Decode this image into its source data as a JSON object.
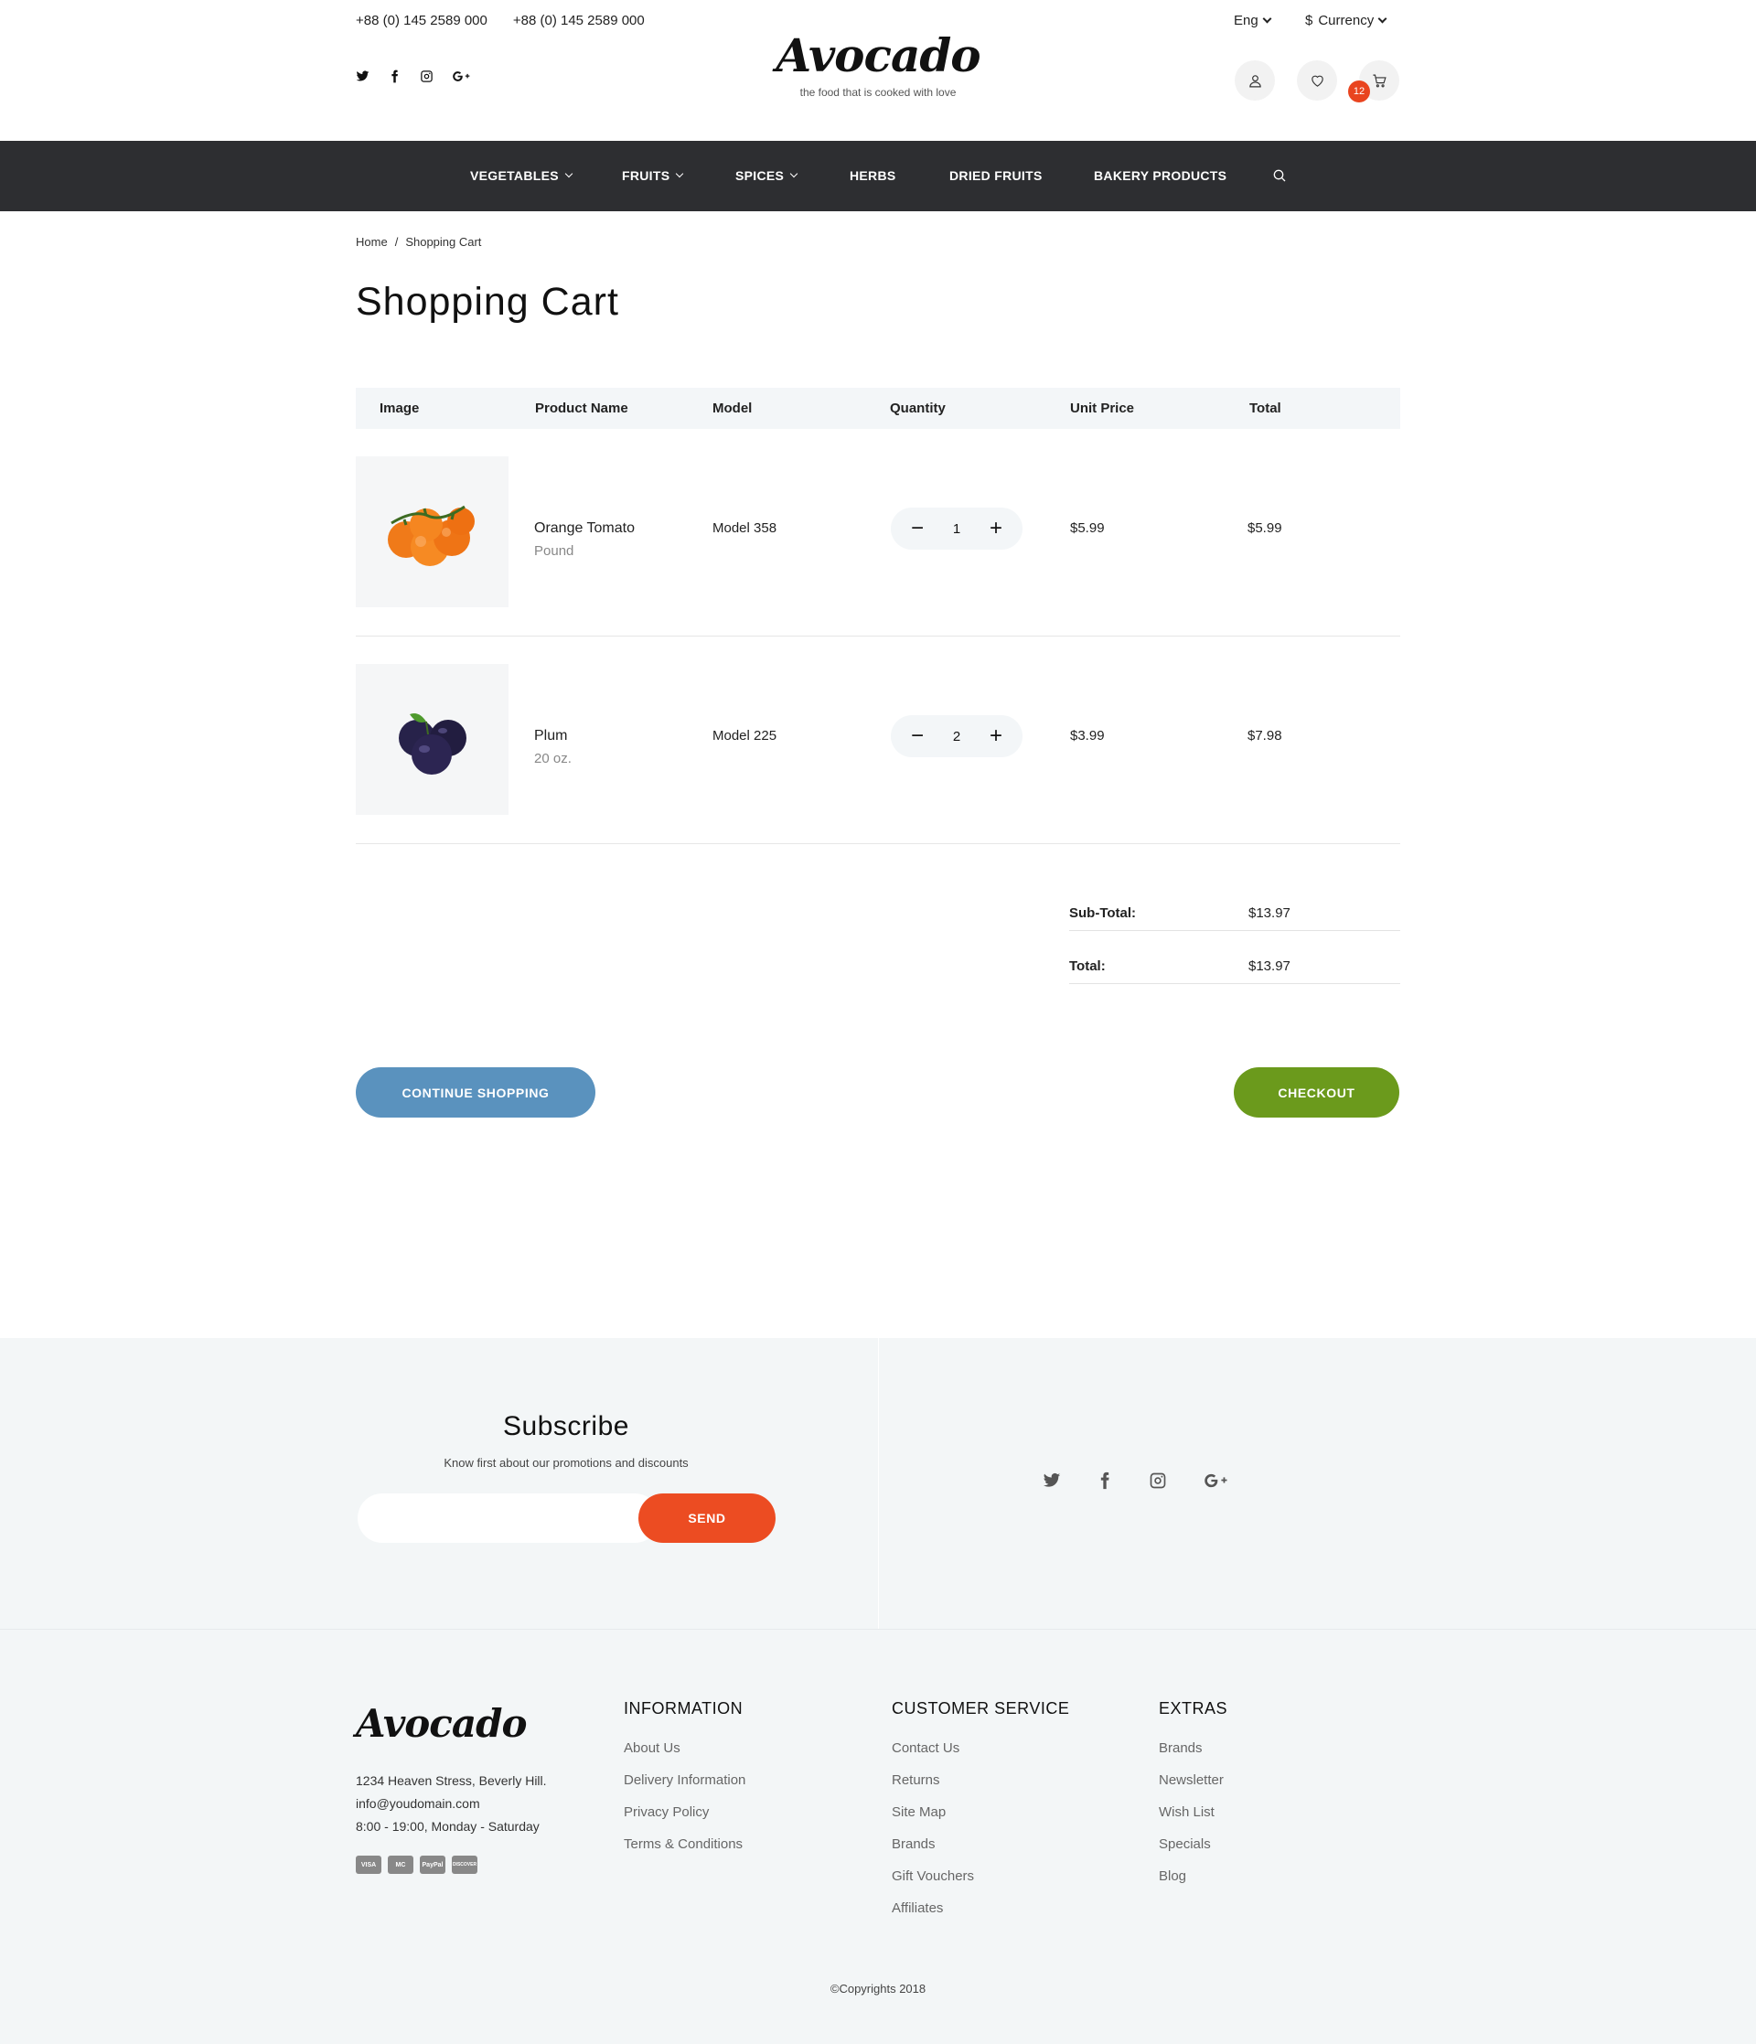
{
  "header": {
    "phone1": "+88 (0) 145 2589 000",
    "phone2": "+88 (0) 145 2589 000",
    "logo": "Avocado",
    "tagline": "the food that is cooked with love",
    "language": "Eng",
    "currency_symbol": "$",
    "currency_label": "Currency",
    "cart_count": "12"
  },
  "nav": {
    "items": [
      {
        "label": "VEGETABLES"
      },
      {
        "label": "FRUITS"
      },
      {
        "label": "SPICES"
      },
      {
        "label": "HERBS"
      },
      {
        "label": "DRIED FRUITS"
      },
      {
        "label": "BAKERY PRODUCTS"
      }
    ]
  },
  "breadcrumb": {
    "home": "Home",
    "separator": "/",
    "current": "Shopping Cart"
  },
  "page": {
    "title": "Shopping Cart"
  },
  "cart": {
    "columns": [
      "Image",
      "Product Name",
      "Model",
      "Quantity",
      "Unit Price",
      "Total"
    ],
    "items": [
      {
        "name": "Orange Tomato",
        "unit": "Pound",
        "model": "Model 358",
        "quantity": "1",
        "unit_price": "$5.99",
        "total": "$5.99"
      },
      {
        "name": "Plum",
        "unit": "20 oz.",
        "model": "Model 225",
        "quantity": "2",
        "unit_price": "$3.99",
        "total": "$7.98"
      }
    ],
    "subtotal_label": "Sub-Total:",
    "subtotal": "$13.97",
    "total_label": "Total:",
    "total": "$13.97",
    "continue_label": "CONTINUE SHOPPING",
    "checkout_label": "CHECKOUT"
  },
  "subscribe": {
    "title": "Subscribe",
    "text": "Know first about our promotions and discounts",
    "placeholder": "",
    "send_label": "SEND"
  },
  "footer": {
    "logo": "Avocado",
    "address": "1234 Heaven Stress, Beverly Hill.",
    "email": "info@youdomain.com",
    "hours": "8:00 - 19:00, Monday - Saturday",
    "payments": [
      "VISA",
      "MC",
      "PayPal",
      "DISCOVER"
    ],
    "information": {
      "title": "INFORMATION",
      "links": [
        "About Us",
        "Delivery Information",
        "Privacy Policy",
        "Terms & Conditions"
      ]
    },
    "customer_service": {
      "title": "CUSTOMER SERVICE",
      "links": [
        "Contact Us",
        "Returns",
        "Site Map",
        "Brands",
        "Gift Vouchers",
        "Affiliates"
      ]
    },
    "extras": {
      "title": "EXTRAS",
      "links": [
        "Brands",
        "Newsletter",
        "Wish List",
        "Specials",
        "Blog"
      ]
    },
    "copyright": "©Copyrights 2018"
  },
  "colors": {
    "nav_bg": "#2d2e31",
    "continue": "#5a92be",
    "checkout": "#6b9a1c",
    "send": "#ec4c22",
    "badge": "#e9441f"
  }
}
